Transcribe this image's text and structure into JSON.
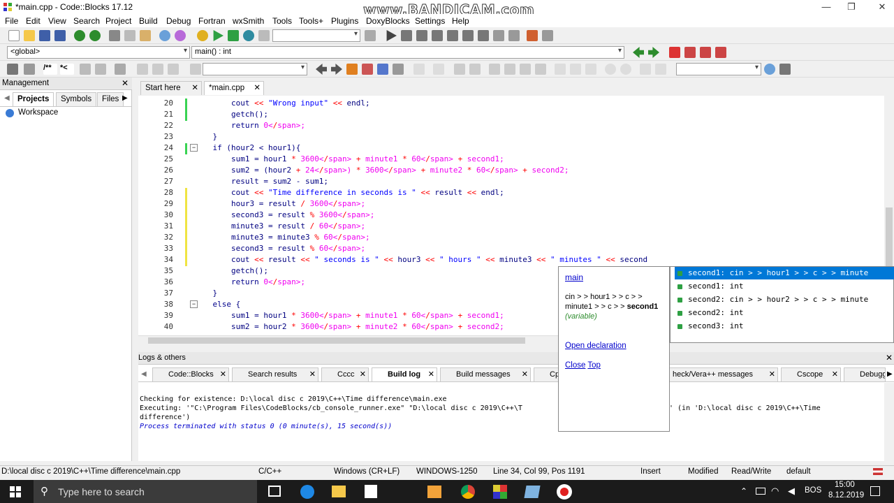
{
  "window": {
    "title": "*main.cpp - Code::Blocks 17.12",
    "watermark": "www.BANDICAM.com",
    "minimize": "—",
    "maximize": "❐",
    "close": "✕"
  },
  "menu": [
    "File",
    "Edit",
    "View",
    "Search",
    "Project",
    "Build",
    "Debug",
    "Fortran",
    "wxSmith",
    "Tools",
    "Tools+",
    "Plugins",
    "DoxyBlocks",
    "Settings",
    "Help"
  ],
  "scope_combo": {
    "global": "<global>",
    "function": "main() : int"
  },
  "management": {
    "title": "Management",
    "tabs": [
      "Projects",
      "Symbols",
      "Files"
    ],
    "tree": {
      "workspace": "Workspace"
    }
  },
  "editor_tabs": [
    {
      "label": "Start here"
    },
    {
      "label": "*main.cpp"
    }
  ],
  "code": {
    "lines": [
      {
        "n": "20",
        "t": "        cout << \"Wrong input\" << endl;"
      },
      {
        "n": "21",
        "t": "        getch();"
      },
      {
        "n": "22",
        "t": "        return 0;"
      },
      {
        "n": "23",
        "t": "    }"
      },
      {
        "n": "24",
        "t": "    if (hour2 < hour1){"
      },
      {
        "n": "25",
        "t": "        sum1 = hour1 * 3600 + minute1 * 60 + second1;"
      },
      {
        "n": "26",
        "t": "        sum2 = (hour2 + 24) * 3600 + minute2 * 60 + second2;"
      },
      {
        "n": "27",
        "t": "        result = sum2 - sum1;"
      },
      {
        "n": "28",
        "t": "        cout << \"Time difference in seconds is \" << result << endl;"
      },
      {
        "n": "29",
        "t": "        hour3 = result / 3600;"
      },
      {
        "n": "30",
        "t": "        second3 = result % 3600;"
      },
      {
        "n": "31",
        "t": "        minute3 = result / 60;"
      },
      {
        "n": "32",
        "t": "        minute3 = minute3 % 60;"
      },
      {
        "n": "33",
        "t": "        second3 = result % 60;"
      },
      {
        "n": "34",
        "t": "        cout << result << \" seconds is \" << hour3 << \" hours \" << minute3 << \" minutes \" << second"
      },
      {
        "n": "35",
        "t": "        getch();"
      },
      {
        "n": "36",
        "t": "        return 0;"
      },
      {
        "n": "37",
        "t": "    }"
      },
      {
        "n": "38",
        "t": "    else {"
      },
      {
        "n": "39",
        "t": "        sum1 = hour1 * 3600 + minute1 * 60 + second1;"
      },
      {
        "n": "40",
        "t": "        sum2 = hour2 * 3600 + minute2 * 60 + second2;"
      }
    ]
  },
  "autocomplete": {
    "doc": {
      "link": "main",
      "signature_a": "cin > > hour1 > > c > >",
      "signature_b": "minute1 > > c > > ",
      "signature_bold": "second1",
      "kind": "(variable)",
      "open_decl": "Open declaration",
      "close": "Close",
      "top": "Top"
    },
    "items": [
      "second1: cin > > hour1 > > c > > minute",
      "second1: int",
      "second2: cin > > hour2 > > c > > minute",
      "second2: int",
      "second3: int"
    ]
  },
  "logs": {
    "title": "Logs & others",
    "tabs": [
      "Code::Blocks",
      "Search results",
      "Cccc",
      "Build log",
      "Build messages",
      "Cpp",
      "heck/Vera++ messages",
      "Cscope",
      "Debugge"
    ],
    "lines": [
      "Checking for existence: D:\\local disc c 2019\\C++\\Time difference\\main.exe",
      "Executing: '\"C:\\Program Files\\CodeBlocks/cb_console_runner.exe\" \"D:\\local disc c 2019\\C++\\T",
      "difference')",
      "Process terminated with status 0 (0 minute(s), 15 second(s))"
    ],
    "line2_tail": "' (in 'D:\\local disc c 2019\\C++\\Time"
  },
  "status": {
    "path": "D:\\local disc c 2019\\C++\\Time difference\\main.cpp",
    "lang": "C/C++",
    "eol": "Windows (CR+LF)",
    "encoding": "WINDOWS-1250",
    "position": "Line 34, Col 99, Pos 1191",
    "mode": "Insert",
    "modified": "Modified",
    "rw": "Read/Write",
    "profile": "default"
  },
  "taskbar": {
    "search_placeholder": "Type here to search",
    "lang": "BOS",
    "time": "15:00",
    "date": "8.12.2019"
  },
  "colors": {
    "selection": "#0078d7",
    "taskbar": "#1b1b1b",
    "green_marker": "#39d353",
    "yellow_marker": "#f0e442"
  }
}
